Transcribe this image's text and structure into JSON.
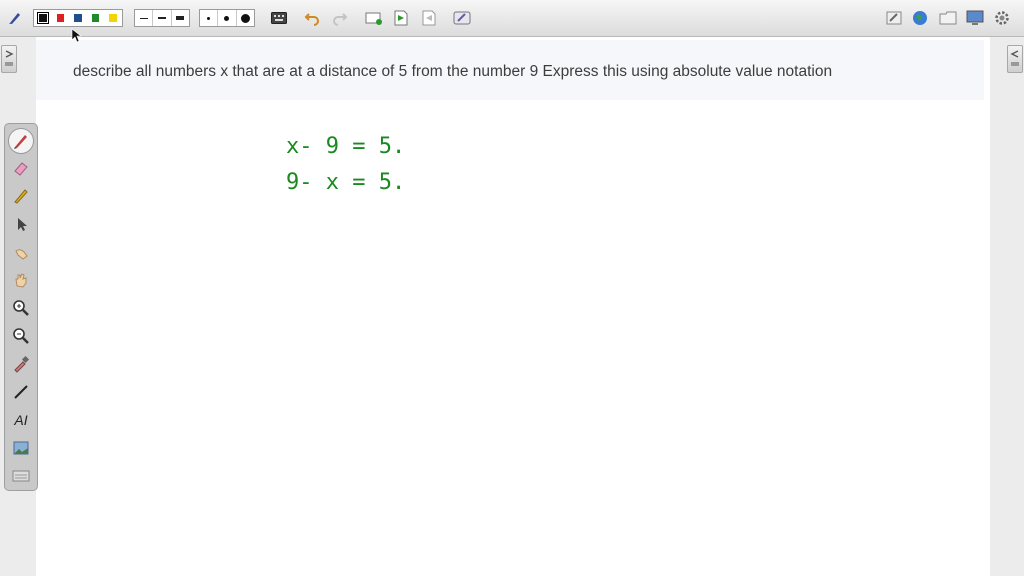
{
  "toolbar": {
    "pen_palette": [
      "#111111",
      "#e02020",
      "#1f4f8f",
      "#1e8a2a",
      "#f2d400"
    ],
    "line_widths": [
      "thin",
      "medium",
      "thick"
    ],
    "dot_sizes": [
      "small",
      "medium",
      "large"
    ],
    "left_icons": [
      "pen-menu-icon",
      "keyboard-icon",
      "undo-icon",
      "redo-icon",
      "new-page-icon",
      "next-page-icon",
      "prev-page-icon",
      "settings-pen-icon"
    ],
    "right_icons": [
      "edit-icon",
      "globe-icon",
      "folder-icon",
      "screen-icon",
      "gear-icon"
    ]
  },
  "question": {
    "text": "describe all numbers x that are at a distance of 5 from the number 9 Express this using absolute value notation"
  },
  "handwriting": {
    "color": "#1a8a20",
    "lines": [
      "x- 9 =  5.",
      "9- x = 5."
    ]
  },
  "tools": [
    "pen-tool",
    "eraser-tool",
    "highlighter-tool",
    "select-arrow-tool",
    "pointer-hand-tool",
    "pan-hand-tool",
    "zoom-in-tool",
    "zoom-out-tool",
    "eyedropper-tool",
    "line-tool",
    "text-tool",
    "image-tool",
    "keyboard-tool"
  ],
  "tool_labels": {
    "text_tool": "AI"
  }
}
